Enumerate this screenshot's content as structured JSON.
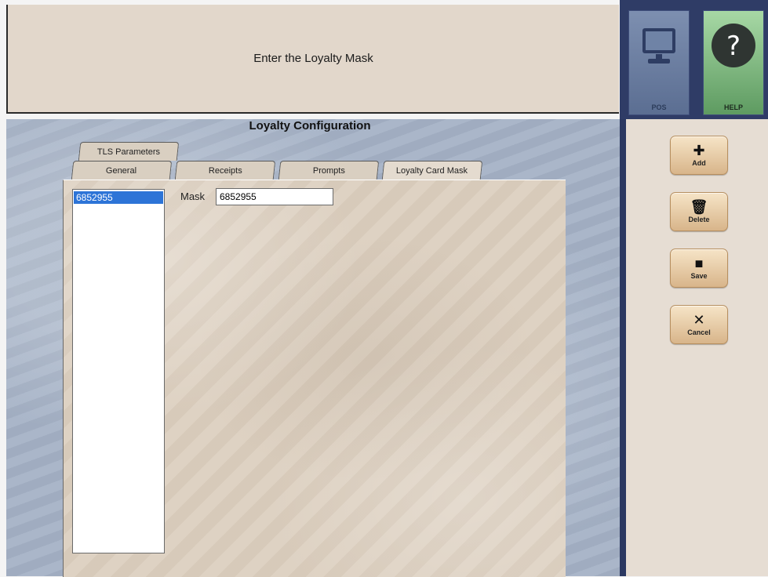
{
  "prompt": {
    "text": "Enter the Loyalty Mask"
  },
  "top_tiles": [
    {
      "label": "POS",
      "icon": "monitor-icon"
    },
    {
      "label": "HELP",
      "icon": "question-icon"
    }
  ],
  "screen": {
    "title": "Loyalty Configuration"
  },
  "tabs": {
    "row1": [
      "TLS Parameters"
    ],
    "row2": [
      "General",
      "Receipts",
      "Prompts",
      "Loyalty Card Mask"
    ],
    "active": "Loyalty Card Mask"
  },
  "mask_list": {
    "items": [
      "6852955"
    ],
    "selected": "6852955"
  },
  "mask_field": {
    "label": "Mask",
    "value": "6852955"
  },
  "actions": [
    {
      "label": "Add",
      "icon": "plus-icon"
    },
    {
      "label": "Delete",
      "icon": "trash-icon"
    },
    {
      "label": "Save",
      "icon": "floppy-icon"
    },
    {
      "label": "Cancel",
      "icon": "x-icon"
    }
  ],
  "colors": {
    "workarea": "#a5b2c6",
    "divider": "#2b3861",
    "selection": "#2d74d7",
    "button": "#d8b58a"
  }
}
